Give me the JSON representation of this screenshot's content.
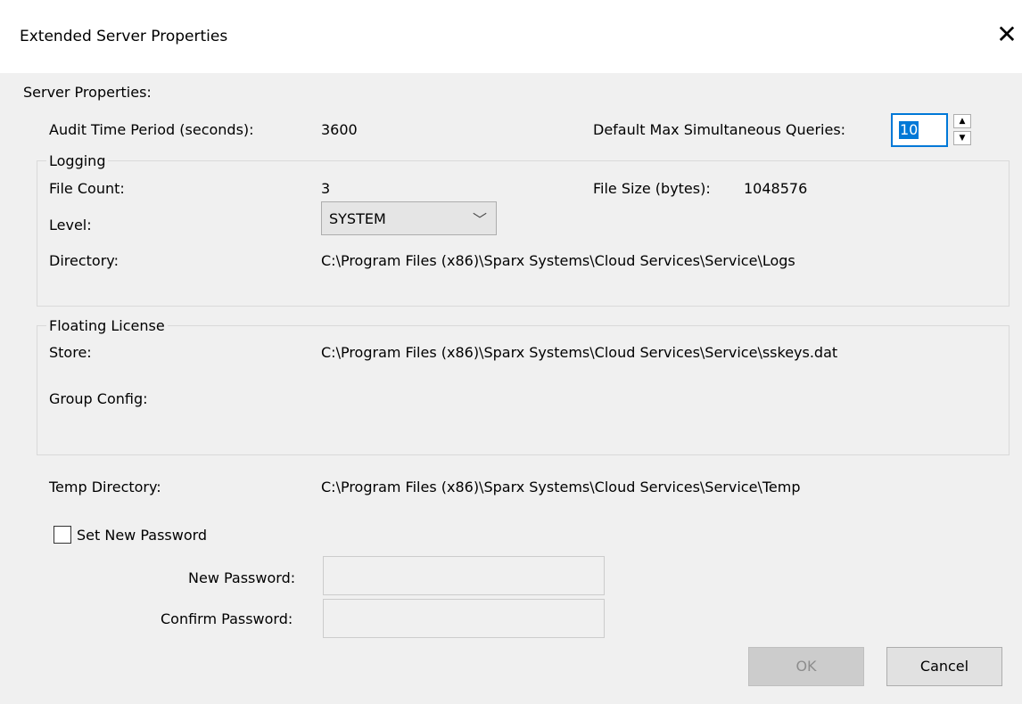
{
  "window": {
    "title": "Extended Server Properties",
    "close_glyph": "✕"
  },
  "server_properties": {
    "heading": "Server Properties:",
    "audit_label": "Audit Time Period (seconds):",
    "audit_value": "3600",
    "max_queries_label": "Default Max Simultaneous Queries:",
    "max_queries_value": "10"
  },
  "logging": {
    "legend": "Logging",
    "file_count_label": "File Count:",
    "file_count_value": "3",
    "file_size_label": "File Size (bytes):",
    "file_size_value": "1048576",
    "level_label": "Level:",
    "level_value": "SYSTEM",
    "directory_label": "Directory:",
    "directory_value": "C:\\Program Files (x86)\\Sparx Systems\\Cloud Services\\Service\\Logs"
  },
  "floating_license": {
    "legend": "Floating License",
    "store_label": "Store:",
    "store_value": "C:\\Program Files (x86)\\Sparx Systems\\Cloud Services\\Service\\sskeys.dat",
    "group_config_label": "Group Config:",
    "group_config_value": ""
  },
  "temp": {
    "label": "Temp Directory:",
    "value": "C:\\Program Files (x86)\\Sparx Systems\\Cloud Services\\Service\\Temp"
  },
  "password": {
    "set_new_label": "Set New Password",
    "set_new_checked": false,
    "new_label": "New Password:",
    "new_value": "",
    "confirm_label": "Confirm Password:",
    "confirm_value": ""
  },
  "buttons": {
    "ok": "OK",
    "ok_enabled": false,
    "cancel": "Cancel"
  },
  "icons": {
    "close": "close-icon",
    "spin_up": "spin-up-icon",
    "spin_down": "spin-down-icon",
    "dropdown": "chevron-down-icon"
  }
}
